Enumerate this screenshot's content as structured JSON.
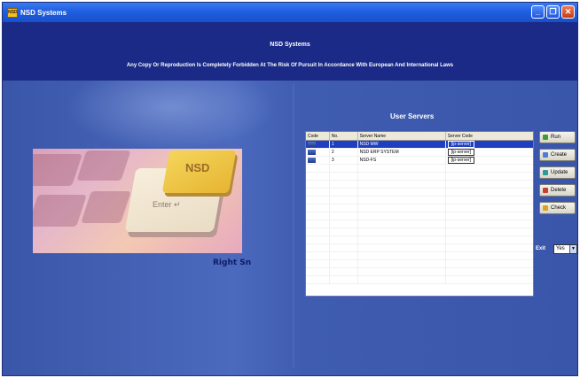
{
  "window": {
    "title": "NSD Systems",
    "app_icon_text": "NSD",
    "icon_name": "nsd-app-icon",
    "controls": [
      "minimize",
      "restore",
      "close"
    ]
  },
  "header": {
    "title": "NSD Systems",
    "notice": "Any Copy Or Reproduction Is Completely Forbidden At The Risk Of Pursuit In Accordance With European And International Laws"
  },
  "image": {
    "key_top_text": "NSD",
    "key_text": "Enter ↵"
  },
  "footer_left": {
    "label": "Right Sn"
  },
  "servers": {
    "title": "User Servers",
    "columns": [
      "Code",
      "No.",
      "Server Name",
      "Server Code"
    ],
    "rows": [
      {
        "no": "1",
        "name": "NSD MW",
        "code": "[ip-server]",
        "selected": true
      },
      {
        "no": "2",
        "name": "NSD ERP SYSTEM",
        "code": "[ip-server]",
        "selected": false
      },
      {
        "no": "3",
        "name": "NSD-FS",
        "code": "[ip-server]",
        "selected": false
      }
    ]
  },
  "buttons": {
    "run": "Run",
    "create": "Create",
    "update": "Update",
    "delete": "Delete",
    "check": "Check"
  },
  "exit": {
    "label": "Exit",
    "value": "Yes"
  },
  "colors": {
    "background": "#3f5cb0",
    "header": "#1a2a86",
    "selection": "#1f3fc0"
  }
}
